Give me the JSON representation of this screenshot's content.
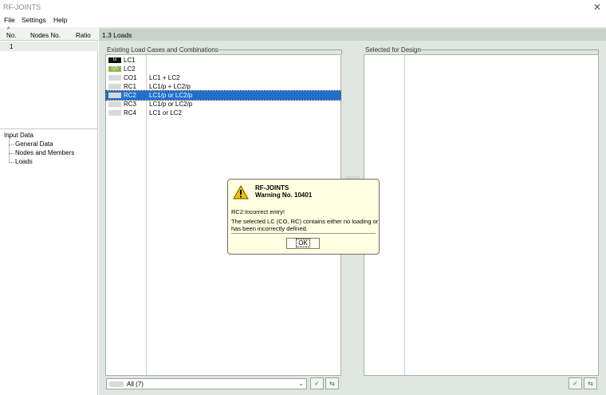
{
  "window": {
    "title": "RF-JOINTS",
    "close_glyph": "✕"
  },
  "menu": {
    "file": "File",
    "settings": "Settings",
    "help": "Help"
  },
  "left": {
    "columns": {
      "sort_glyph": "^",
      "no": "No.",
      "nodes": "Nodes No.",
      "ratio": "Ratio"
    },
    "rows": [
      {
        "no": "1"
      }
    ],
    "tree": {
      "root": "Input Data",
      "items": [
        "General Data",
        "Nodes and Members",
        "Loads"
      ]
    }
  },
  "main": {
    "header": "1.3 Loads",
    "existing": {
      "label": "Existing Load Cases and Combinations",
      "items": [
        {
          "badge": "G",
          "badge_color": "#111111",
          "id": "LC1",
          "desc": ""
        },
        {
          "badge": "Qs",
          "badge_color": "#8db84a",
          "id": "LC2",
          "desc": ""
        },
        {
          "badge": "",
          "badge_color": "#d9d9d9",
          "id": "CO1",
          "desc": "LC1 + LC2"
        },
        {
          "badge": "",
          "badge_color": "#d9d9d9",
          "id": "RC1",
          "desc": "LC1/p + LC2/p"
        },
        {
          "badge": "",
          "badge_color": "#d9d9d9",
          "id": "RC2",
          "desc": "LC1/p or LC2/p"
        },
        {
          "badge": "",
          "badge_color": "#d9d9d9",
          "id": "RC3",
          "desc": "LC1/p or LC2/p"
        },
        {
          "badge": "",
          "badge_color": "#d9d9d9",
          "id": "RC4",
          "desc": "LC1 or LC2"
        }
      ],
      "selected_index": 4
    },
    "selected": {
      "label": "Selected for Design"
    },
    "filter": {
      "value": "All (7)",
      "arrow": "⌄"
    },
    "icons": {
      "check": "✓",
      "select": "⇆"
    }
  },
  "dialog": {
    "title": "RF-JOINTS",
    "subtitle": "Warning No. 10401",
    "lines": [
      "RC2:Incorrect entry!",
      "The selected LC (CO, RC) contains either no loading or",
      "has been incorrectly defined."
    ],
    "ok_label": "OK"
  }
}
